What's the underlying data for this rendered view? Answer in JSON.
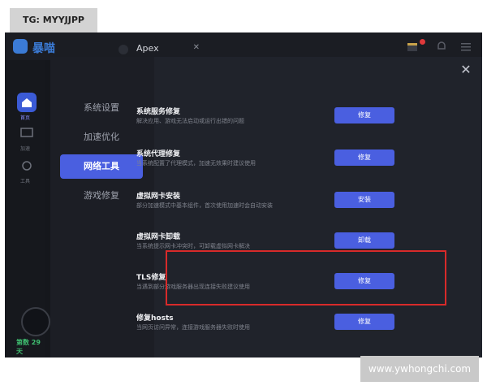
{
  "watermark_tag": "TG: MYYJJPP",
  "watermark_site": "www.ywhongchi.com",
  "app": {
    "logo_text": "暴喵",
    "game_tab": "Apex"
  },
  "sidebar": {
    "items": [
      {
        "label": "首页"
      },
      {
        "label": "加速"
      },
      {
        "label": "工具"
      }
    ],
    "days_text": "第数 29 天"
  },
  "modal": {
    "nav": [
      {
        "label": "系统设置"
      },
      {
        "label": "加速优化"
      },
      {
        "label": "网络工具",
        "active": true
      },
      {
        "label": "游戏修复"
      }
    ],
    "rows": [
      {
        "title": "系统服务修复",
        "desc": "解决应用、游戏无法启动或运行出错的问题",
        "button": "修复"
      },
      {
        "title": "系统代理修复",
        "desc": "当系统配置了代理模式，加速无效果时建议使用",
        "button": "修复"
      },
      {
        "title": "虚拟网卡安装",
        "desc": "部分加速模式中基本组件，首次使用加速时会自动安装",
        "button": "安装"
      },
      {
        "title": "虚拟网卡卸载",
        "desc": "当系统提示网卡冲突时，可卸载虚拟网卡解决",
        "button": "卸载"
      },
      {
        "title": "TLS修复",
        "desc": "当遇到部分游戏服务器出现连接失败建议使用",
        "button": "修复"
      },
      {
        "title": "修复hosts",
        "desc": "当网页访问异常，连接游戏服务器失败时使用",
        "button": "修复"
      }
    ]
  },
  "colors": {
    "accent": "#4a5fe0",
    "highlight": "#d82a2a",
    "background": "#20232b"
  }
}
